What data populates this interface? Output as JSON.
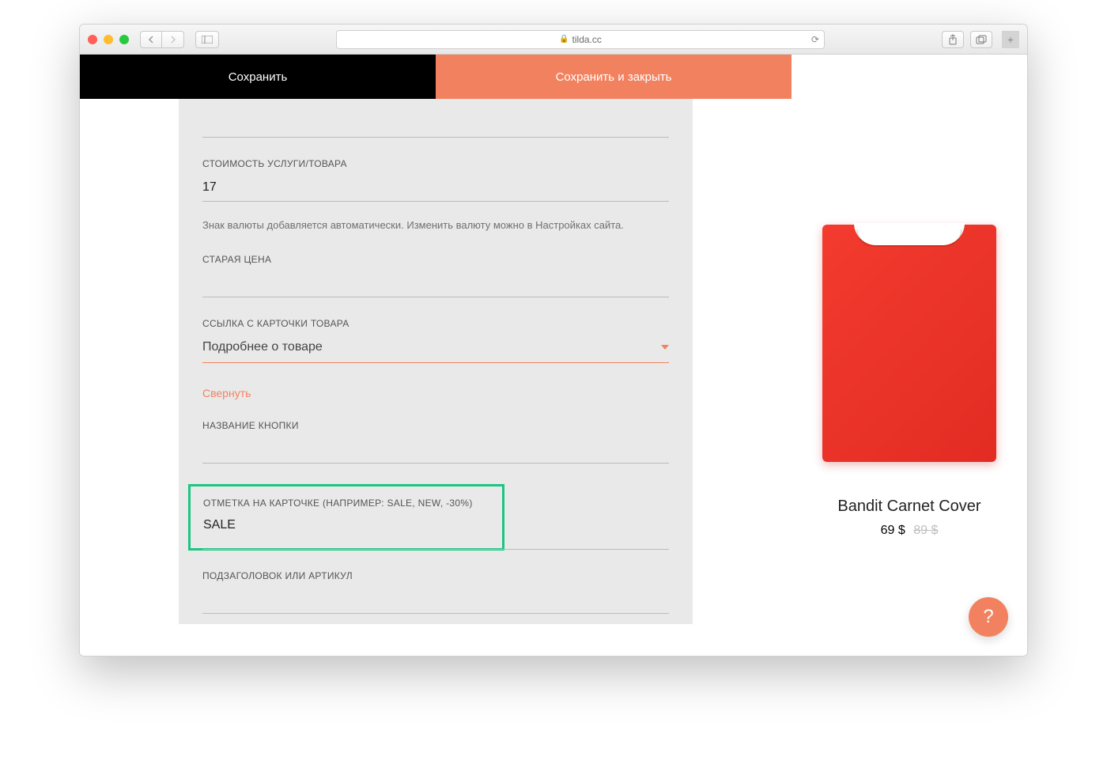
{
  "browser": {
    "url_host": "tilda.cc"
  },
  "header": {
    "save": "Сохранить",
    "save_close": "Сохранить и закрыть"
  },
  "form": {
    "price_label": "СТОИМОСТЬ УСЛУГИ/ТОВАРА",
    "price_value": "17",
    "price_hint": "Знак валюты добавляется автоматически. Изменить валюту можно в Настройках сайта.",
    "oldprice_label": "СТАРАЯ ЦЕНА",
    "oldprice_value": "",
    "link_label": "ССЫЛКА С КАРТОЧКИ ТОВАРА",
    "link_value": "Подробнее о товаре",
    "collapse": "Свернуть",
    "button_label": "НАЗВАНИЕ КНОПКИ",
    "button_value": "",
    "mark_label": "ОТМЕТКА НА КАРТОЧКЕ (НАПРИМЕР: SALE, NEW, -30%)",
    "mark_value": "SALE",
    "subtitle_label": "ПОДЗАГОЛОВОК ИЛИ АРТИКУЛ",
    "subtitle_value": ""
  },
  "preview": {
    "title": "Bandit Carnet Cover",
    "price": "69 $",
    "old_price": "89 $"
  },
  "help": "?"
}
